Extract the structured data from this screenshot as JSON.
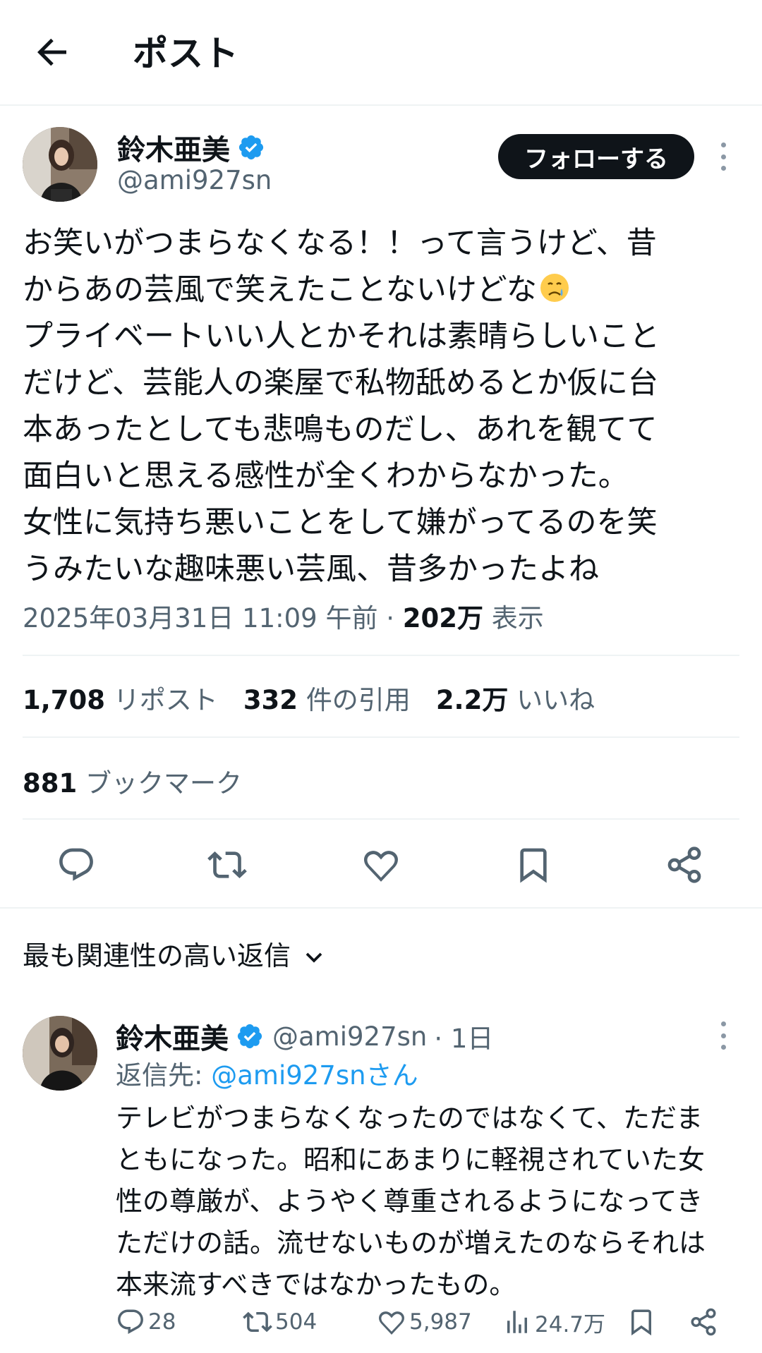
{
  "header": {
    "title": "ポスト"
  },
  "post": {
    "author": {
      "name": "鈴木亜美",
      "handle": "@ami927sn"
    },
    "follow_label": "フォローする",
    "text_lines": [
      "お笑いがつまらなくなる！！って言うけど、昔",
      "からあの芸風で笑えたことないけどな",
      "プライベートいい人とかそれは素晴らしいこと",
      "だけど、芸能人の楽屋で私物舐めるとか仮に台",
      "本あったとしても悲鳴ものだし、あれを観てて",
      "面白いと思える感性が全くわからなかった。",
      "女性に気持ち悪いことをして嫌がってるのを笑",
      "うみたいな趣味悪い芸風、昔多かったよね"
    ],
    "emoji_icon": "crying-face-icon",
    "timestamp": "2025年03月31日 11:09 午前",
    "separator": "·",
    "views_count": "202万",
    "views_label": "表示",
    "stats": {
      "reposts_count": "1,708",
      "reposts_label": "リポスト",
      "quotes_count": "332",
      "quotes_label": "件の引用",
      "likes_count": "2.2万",
      "likes_label": "いいね",
      "bookmarks_count": "881",
      "bookmarks_label": "ブックマーク"
    },
    "action_icons": [
      "reply-icon",
      "repost-icon",
      "like-icon",
      "bookmark-icon",
      "share-icon"
    ]
  },
  "replies_sort": {
    "label": "最も関連性の高い返信"
  },
  "reply": {
    "author": {
      "name": "鈴木亜美",
      "handle": "@ami927sn",
      "time": "· 1日"
    },
    "reply_to_label": "返信先: ",
    "reply_to_mention": "@ami927snさん",
    "text_lines": [
      "テレビがつまらなくなったのではなくて、ただま",
      "ともになった。昭和にあまりに軽視されていた女",
      "性の尊厳が、ようやく尊重されるようになってき",
      "ただけの話。流せないものが増えたのならそれは",
      "本来流すべきではなかったもの。"
    ],
    "actions": {
      "replies": "28",
      "reposts": "504",
      "likes": "5,987",
      "views": "24.7万"
    }
  },
  "colors": {
    "accent": "#1d9bf0",
    "text": "#0f1419",
    "secondary": "#536471",
    "divider": "#eff3f4"
  }
}
